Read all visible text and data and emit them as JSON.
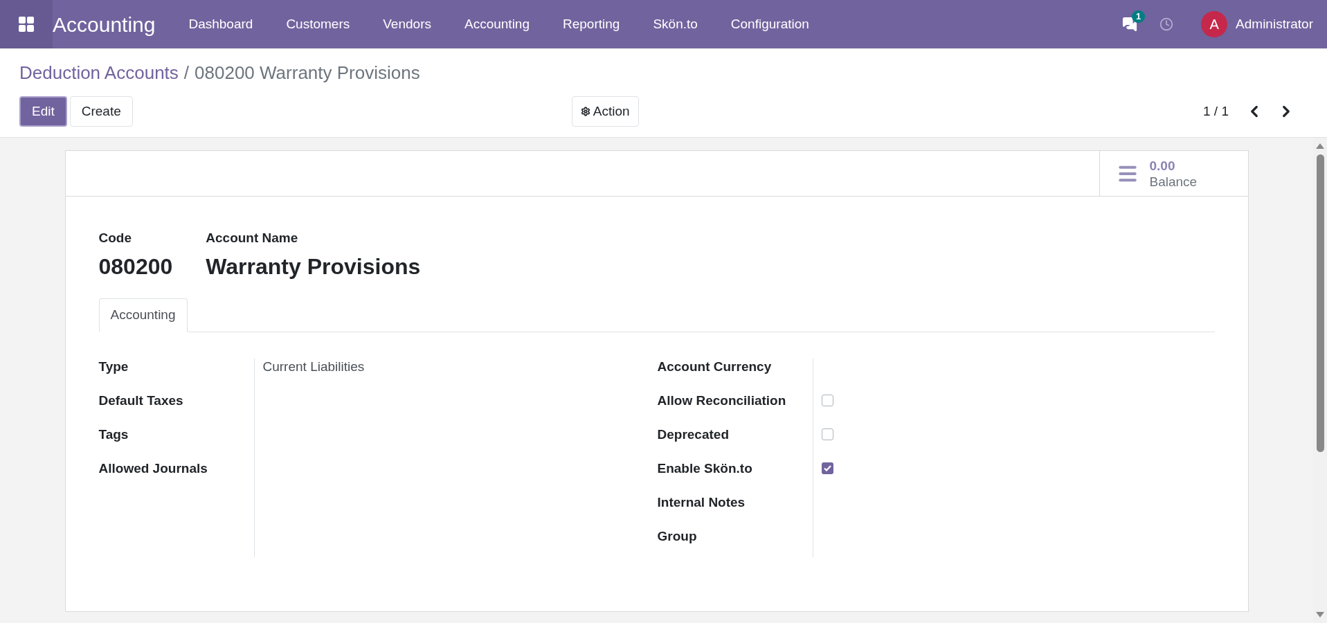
{
  "navbar": {
    "app_name": "Accounting",
    "menu": [
      "Dashboard",
      "Customers",
      "Vendors",
      "Accounting",
      "Reporting",
      "Skön.to",
      "Configuration"
    ],
    "messages_count": "1",
    "user_initial": "A",
    "user_name": "Administrator"
  },
  "breadcrumb": {
    "parent": "Deduction Accounts",
    "separator": "/",
    "current": "080200 Warranty Provisions"
  },
  "buttons": {
    "edit": "Edit",
    "create": "Create",
    "action": "Action"
  },
  "pager": "1 / 1",
  "stat_button": {
    "value": "0.00",
    "label": "Balance"
  },
  "header": {
    "code_label": "Code",
    "code": "080200",
    "name_label": "Account Name",
    "name": "Warranty Provisions"
  },
  "tabs": [
    {
      "label": "Accounting",
      "selected": true
    }
  ],
  "left_fields": [
    {
      "label": "Type",
      "value": "Current Liabilities"
    },
    {
      "label": "Default Taxes"
    },
    {
      "label": "Tags"
    },
    {
      "label": "Allowed Journals"
    }
  ],
  "right_fields": [
    {
      "kind": "text",
      "label": "Account Currency"
    },
    {
      "kind": "checkbox",
      "label": "Allow Reconciliation",
      "checked": false
    },
    {
      "kind": "checkbox",
      "label": "Deprecated",
      "checked": false
    },
    {
      "kind": "checkbox",
      "label": "Enable Skön.to",
      "checked": true
    },
    {
      "kind": "text",
      "label": "Internal Notes"
    },
    {
      "kind": "text",
      "label": "Group"
    }
  ]
}
